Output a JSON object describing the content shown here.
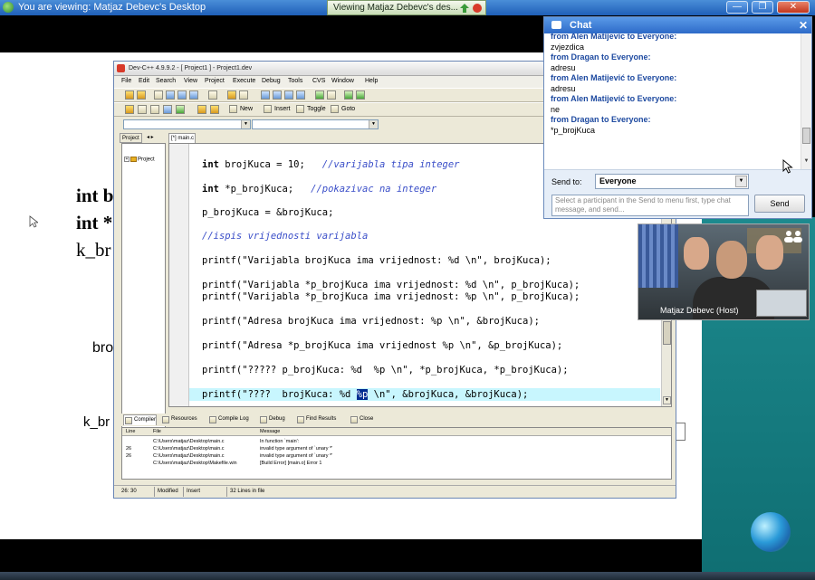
{
  "viewer_bar": {
    "title": "You are viewing: Matjaz Debevc's Desktop",
    "tab_label": "Viewing Matjaz Debevc's des...",
    "minimize_glyph": "—",
    "restore_glyph": "❐",
    "close_glyph": "✕"
  },
  "slide": {
    "lines": [
      "int b",
      "int *",
      "k_br",
      "bro",
      "k_br"
    ]
  },
  "devcpp": {
    "title": "Dev-C++ 4.9.9.2  -  [ Project1 ] - Project1.dev",
    "menu": [
      "File",
      "Edit",
      "Search",
      "View",
      "Project",
      "Execute",
      "Debug",
      "Tools",
      "CVS",
      "Window",
      "Help"
    ],
    "toolbar2_buttons": [
      "New",
      "Insert",
      "Toggle",
      "Goto"
    ],
    "project_tab": "Project",
    "project_tab_arrows": "◂ ▸",
    "project_tree_label": "Project",
    "editor_tab": "[*] main.c",
    "code": {
      "l1_kw": "int",
      "l1_rest": " brojKuca = 10;   ",
      "l1_cm": "//varijabla tipa integer",
      "l2_kw": "int",
      "l2_rest": " *p_brojKuca;   ",
      "l2_cm": "//pokazivac na integer",
      "l3": "p_brojKuca = &brojKuca;",
      "l4_cm": "//ispis vrijednosti varijabla",
      "l5": "printf(\"Varijabla brojKuca ima vrijednost: %d \\n\", brojKuca);",
      "l6": "printf(\"Varijabla *p_brojKuca ima vrijednost: %d \\n\", p_brojKuca);",
      "l7": "printf(\"Varijabla *p_brojKuca ima vrijednost: %p \\n\", p_brojKuca);",
      "l8": "printf(\"Adresa brojKuca ima vrijednost: %p \\n\", &brojKuca);",
      "l9": "printf(\"Adresa *p_brojKuca ima vrijednost %p \\n\", &p_brojKuca);",
      "l10": "printf(\"????? p_brojKuca: %d  %p \\n\", *p_brojKuca, *p_brojKuca);",
      "l11_a": "printf(\"????  brojKuca: %d ",
      "l11_sel": "%p",
      "l11_b": " \\n\", &brojKuca, &brojKuca);"
    },
    "bottom_tabs": [
      "Compiler",
      "Resources",
      "Compile Log",
      "Debug",
      "Find Results",
      "Close"
    ],
    "compiler": {
      "headers": [
        "Line",
        "File",
        "Message"
      ],
      "rows": [
        {
          "line": "",
          "file": "C:\\Users\\matjaz\\Desktop\\main.c",
          "message": "In function `main':"
        },
        {
          "line": "26",
          "file": "C:\\Users\\matjaz\\Desktop\\main.c",
          "message": "invalid type argument of `unary *'"
        },
        {
          "line": "26",
          "file": "C:\\Users\\matjaz\\Desktop\\main.c",
          "message": "invalid type argument of `unary *'"
        },
        {
          "line": "",
          "file": "C:\\Users\\matjaz\\Desktop\\Makefile.win",
          "message": "[Build Error]  [main.o] Error 1"
        }
      ]
    },
    "status": {
      "position": "26: 30",
      "modified": "Modified",
      "mode": "Insert",
      "lines": "32 Lines in file"
    }
  },
  "chat": {
    "title": "Chat",
    "close_glyph": "✕",
    "messages": [
      {
        "from": "from Alen Matijevic to Everyone:",
        "text": "zvjezdica"
      },
      {
        "from": "from Dragan to Everyone:",
        "text": "adresu"
      },
      {
        "from": "from Alen Matijević to Everyone:",
        "text": "adresu"
      },
      {
        "from": "from Alen Matijević to Everyone:",
        "text": "ne"
      },
      {
        "from": "from Dragan to Everyone:",
        "text": "*p_brojKuca"
      }
    ],
    "send_to_label": "Send to:",
    "send_to_value": "Everyone",
    "input_placeholder": "Select a participant in the Send to menu first, type chat message, and send...",
    "send_label": "Send"
  },
  "video": {
    "label": "Matjaz Debevc (Host)"
  }
}
